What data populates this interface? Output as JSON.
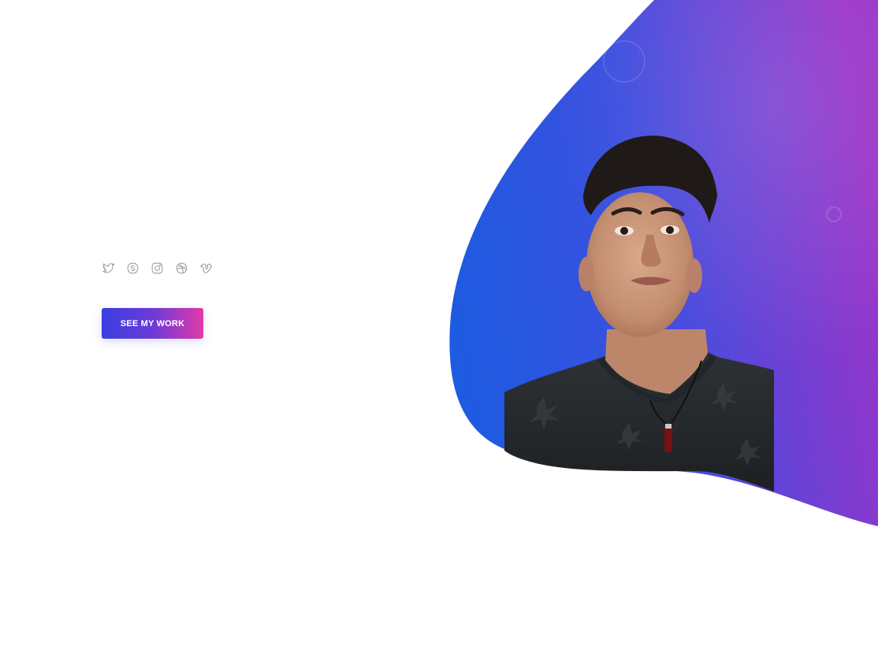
{
  "hero": {
    "cta_label": "SEE MY WORK"
  },
  "social": [
    {
      "icon": "twitter-icon"
    },
    {
      "icon": "skype-icon"
    },
    {
      "icon": "instagram-icon"
    },
    {
      "icon": "dribbble-icon"
    },
    {
      "icon": "vimeo-icon"
    }
  ],
  "colors": {
    "accent_start": "#3a3fe0",
    "accent_end": "#e13aa8",
    "blob_blue": "#1d5be0",
    "blob_purple": "#9a34c9",
    "icon_gray": "#8a9399"
  }
}
